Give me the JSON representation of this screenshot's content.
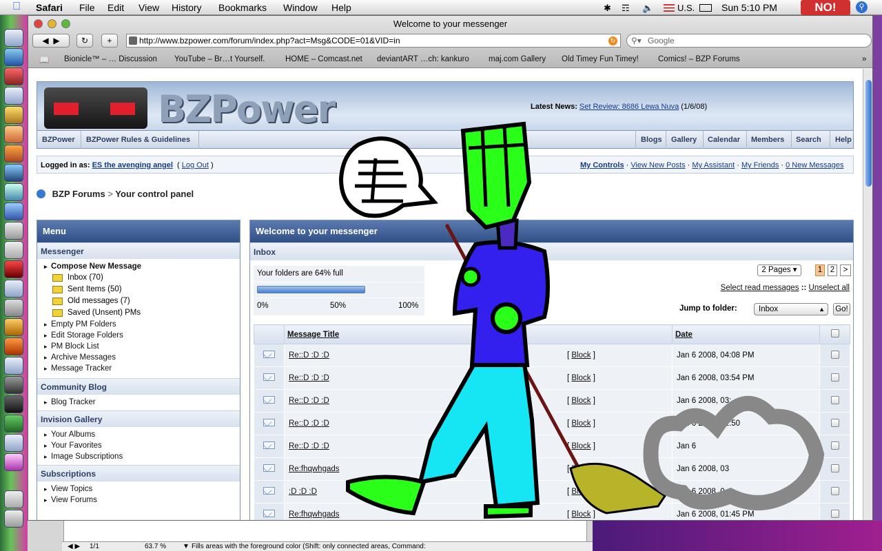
{
  "menubar": {
    "app": "Safari",
    "menus": [
      "File",
      "Edit",
      "View",
      "History",
      "Bookmarks",
      "Window",
      "Help"
    ],
    "input_source": "U.S.",
    "clock": "Sun 5:10 PM",
    "badge": "NO!"
  },
  "window": {
    "title": "Welcome to your messenger",
    "url": "http://www.bzpower.com/forum/index.php?act=Msg&CODE=01&VID=in",
    "search_placeholder": "Google",
    "bookmarks": [
      "Bionicle™ – … Discussion",
      "YouTube – Br…t Yourself.",
      "HOME – Comcast.net",
      "deviantART …ch: kankuro",
      "maj.com Gallery",
      "Old Timey Fun Timey!",
      "Comics! – BZP Forums"
    ]
  },
  "banner": {
    "logo": "BZPower",
    "news_label": "Latest News:",
    "news_link": "Set Review: 8686 Lewa Nuva",
    "news_date": "(1/6/08)"
  },
  "nav": {
    "left": [
      "BZPower",
      "BZPower Rules & Guidelines"
    ],
    "right": [
      "Blogs",
      "Gallery",
      "Calendar",
      "Members",
      "Search",
      "Help"
    ]
  },
  "user": {
    "logged_label": "Logged in as:",
    "username": "ES the avenging angel",
    "logout": "Log Out",
    "links": [
      "My Controls",
      "View New Posts",
      "My Assistant",
      "My Friends",
      "0 New Messages"
    ]
  },
  "breadcrumb": {
    "root": "BZP Forums",
    "sep": ">",
    "current": "Your control panel"
  },
  "menu": {
    "title": "Menu",
    "messenger": {
      "header": "Messenger",
      "compose": "Compose New Message",
      "folders": [
        "Inbox (70)",
        "Sent Items (50)",
        "Old messages (7)",
        "Saved (Unsent) PMs"
      ],
      "links": [
        "Empty PM Folders",
        "Edit Storage Folders",
        "PM Block List",
        "Archive Messages",
        "Message Tracker"
      ]
    },
    "blog": {
      "header": "Community Blog",
      "links": [
        "Blog Tracker"
      ]
    },
    "gallery": {
      "header": "Invision Gallery",
      "links": [
        "Your Albums",
        "Your Favorites",
        "Image Subscriptions"
      ]
    },
    "subs": {
      "header": "Subscriptions",
      "links": [
        "View Topics",
        "View Forums"
      ]
    }
  },
  "messenger": {
    "title": "Welcome to your messenger",
    "folder": "Inbox",
    "quota_text": "Your folders are 64% full",
    "quota_fraction": 0.64,
    "scale": [
      "0%",
      "50%",
      "100%"
    ],
    "pages_label": "2 Pages",
    "page_numbers": [
      "1",
      "2",
      ">"
    ],
    "select_read": "Select read messages",
    "unselect": "Unselect all",
    "separator": "::",
    "jump_label": "Jump to folder:",
    "jump_value": "Inbox",
    "go": "Go!",
    "columns": [
      "Message Title",
      "Date"
    ],
    "rows": [
      {
        "title": "Re::D :D :D",
        "block": "Block",
        "date": "Jan 6 2008, 04:08 PM"
      },
      {
        "title": "Re::D :D :D",
        "block": "Block",
        "date": "Jan 6 2008, 03:54 PM"
      },
      {
        "title": "Re::D :D :D",
        "block": "Block",
        "date": "Jan 6 2008, 03:"
      },
      {
        "title": "Re::D :D :D",
        "block": "Block",
        "date": "Jan 6 2008, 02:50"
      },
      {
        "title": "Re::D :D :D",
        "block": "Block",
        "date": "Jan 6"
      },
      {
        "title": "Re:fhqwhgads",
        "block": "Block",
        "date": "Jan 6 2008, 03"
      },
      {
        "title": ":D :D :D",
        "block": "Block",
        "date": "Jan 6 2008, 0"
      },
      {
        "title": "Re:fhqwhgads",
        "block": "Block",
        "date": "Jan 6 2008, 01:45 PM"
      }
    ]
  },
  "bottom_app": {
    "page": "1/1",
    "zoom": "63.7 %",
    "status": "Fills areas with the foreground color (Shift: only connected areas, Command:"
  }
}
